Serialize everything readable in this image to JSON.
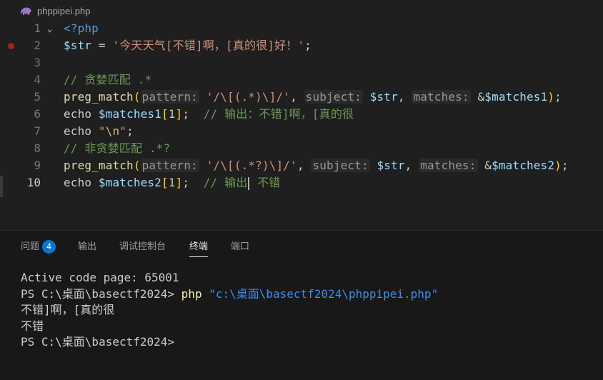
{
  "tab": {
    "filename": "phppipei.php",
    "icon": "php-elephant-icon"
  },
  "editor": {
    "lines": [
      {
        "num": "1",
        "parts": [
          {
            "t": "<?php",
            "c": "kw-tag"
          }
        ],
        "fold": "⌄"
      },
      {
        "num": "2",
        "breakpoint": true,
        "parts": [
          {
            "t": "$str",
            "c": "var"
          },
          {
            "t": " = ",
            "c": "op"
          },
          {
            "t": "'今天天气[不错]啊，[真的很]好！'",
            "c": "str"
          },
          {
            "t": ";",
            "c": "op"
          }
        ]
      },
      {
        "num": "3",
        "parts": []
      },
      {
        "num": "4",
        "parts": [
          {
            "t": "// 贪婪匹配 .*",
            "c": "cmt"
          }
        ]
      },
      {
        "num": "5",
        "parts": [
          {
            "t": "preg_match",
            "c": "fn"
          },
          {
            "t": "(",
            "c": "bracket"
          },
          {
            "t": "pattern:",
            "c": "hint"
          },
          {
            "t": " ",
            "c": "op"
          },
          {
            "t": "'/\\[(.*)\\]/'",
            "c": "str"
          },
          {
            "t": ", ",
            "c": "op"
          },
          {
            "t": "subject:",
            "c": "hint"
          },
          {
            "t": " ",
            "c": "op"
          },
          {
            "t": "$str",
            "c": "var"
          },
          {
            "t": ", ",
            "c": "op"
          },
          {
            "t": "matches:",
            "c": "hint"
          },
          {
            "t": " &",
            "c": "op"
          },
          {
            "t": "$matches1",
            "c": "var"
          },
          {
            "t": ")",
            "c": "bracket"
          },
          {
            "t": ";",
            "c": "op"
          }
        ]
      },
      {
        "num": "6",
        "parts": [
          {
            "t": "echo ",
            "c": "kw"
          },
          {
            "t": "$matches1",
            "c": "var"
          },
          {
            "t": "[",
            "c": "bracket"
          },
          {
            "t": "1",
            "c": "num"
          },
          {
            "t": "]",
            "c": "bracket"
          },
          {
            "t": ";  ",
            "c": "op"
          },
          {
            "t": "// 输出：不错]啊，[真的很",
            "c": "cmt"
          }
        ]
      },
      {
        "num": "7",
        "parts": [
          {
            "t": "echo ",
            "c": "kw"
          },
          {
            "t": "\"",
            "c": "str"
          },
          {
            "t": "\\n",
            "c": "esc"
          },
          {
            "t": "\"",
            "c": "str"
          },
          {
            "t": ";",
            "c": "op"
          }
        ]
      },
      {
        "num": "8",
        "parts": [
          {
            "t": "// 非贪婪匹配 .*?",
            "c": "cmt"
          }
        ]
      },
      {
        "num": "9",
        "parts": [
          {
            "t": "preg_match",
            "c": "fn"
          },
          {
            "t": "(",
            "c": "bracket"
          },
          {
            "t": "pattern:",
            "c": "hint"
          },
          {
            "t": " ",
            "c": "op"
          },
          {
            "t": "'/\\[(.*?)\\]/'",
            "c": "str"
          },
          {
            "t": ", ",
            "c": "op"
          },
          {
            "t": "subject:",
            "c": "hint"
          },
          {
            "t": " ",
            "c": "op"
          },
          {
            "t": "$str",
            "c": "var"
          },
          {
            "t": ", ",
            "c": "op"
          },
          {
            "t": "matches:",
            "c": "hint"
          },
          {
            "t": " &",
            "c": "op"
          },
          {
            "t": "$matches2",
            "c": "var"
          },
          {
            "t": ")",
            "c": "bracket"
          },
          {
            "t": ";",
            "c": "op"
          }
        ]
      },
      {
        "num": "10",
        "active": true,
        "parts": [
          {
            "t": "echo ",
            "c": "kw"
          },
          {
            "t": "$matches2",
            "c": "var"
          },
          {
            "t": "[",
            "c": "bracket"
          },
          {
            "t": "1",
            "c": "num"
          },
          {
            "t": "]",
            "c": "bracket"
          },
          {
            "t": ";  ",
            "c": "op"
          },
          {
            "t": "// 输出",
            "c": "cmt"
          },
          {
            "t": "|cursor|",
            "c": "cursor"
          },
          {
            "t": " 不错",
            "c": "cmt"
          }
        ]
      }
    ]
  },
  "panel": {
    "tabs": [
      {
        "label": "问题",
        "badge": "4"
      },
      {
        "label": "输出"
      },
      {
        "label": "调试控制台"
      },
      {
        "label": "终端",
        "active": true
      },
      {
        "label": "端口"
      }
    ],
    "terminal": [
      {
        "text": "Active code page: 65001"
      },
      {
        "prompt": "PS C:\\桌面\\basectf2024> ",
        "cmd": "php",
        "arg": " \"c:\\桌面\\basectf2024\\phppipei.php\""
      },
      {
        "text": "不错]啊，[真的很"
      },
      {
        "text": "不错"
      },
      {
        "text": "PS C:\\桌面\\basectf2024>"
      }
    ]
  },
  "colors": {
    "background": "#1f1f1f",
    "panel": "#181818",
    "badge": "#0078d4",
    "breakpoint": "#a1260d"
  }
}
